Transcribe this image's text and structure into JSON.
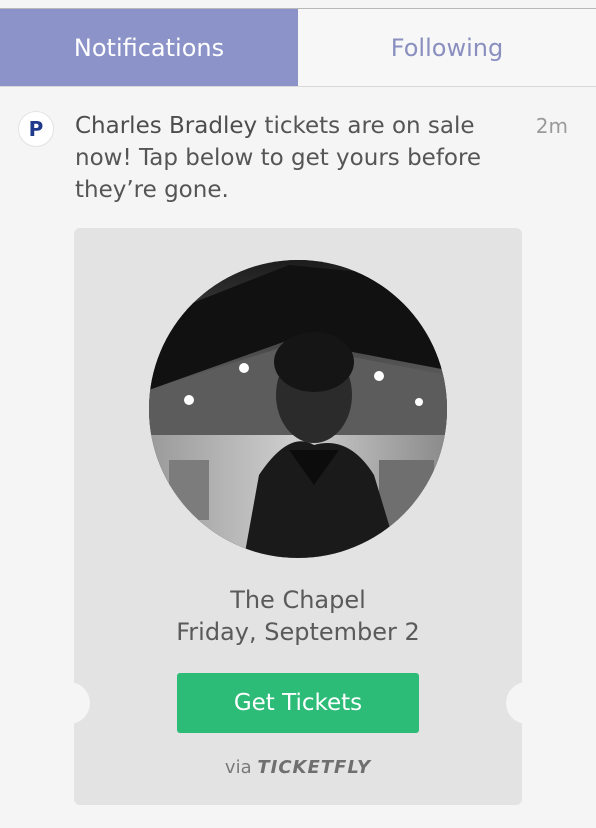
{
  "tabs": [
    {
      "label": "Notifications",
      "active": true
    },
    {
      "label": "Following",
      "active": false
    }
  ],
  "notification": {
    "avatar_letter": "P",
    "artist": "Charles Bradley",
    "message_rest": " tickets are on sale now! Tap below to get yours before they’re gone.",
    "time": "2m"
  },
  "ticket": {
    "photo_icon": "artist-photo",
    "venue": "The Chapel",
    "date": "Friday, September 2",
    "button_label": "Get Tickets",
    "via_label": "via",
    "provider": "TICKETFLY"
  },
  "colors": {
    "active_tab": "#8c93c9",
    "inactive_tab_text": "#8a8fbf",
    "button": "#2dbb78",
    "ticket_bg": "#e3e3e3",
    "avatar_letter": "#1f3a8a"
  }
}
